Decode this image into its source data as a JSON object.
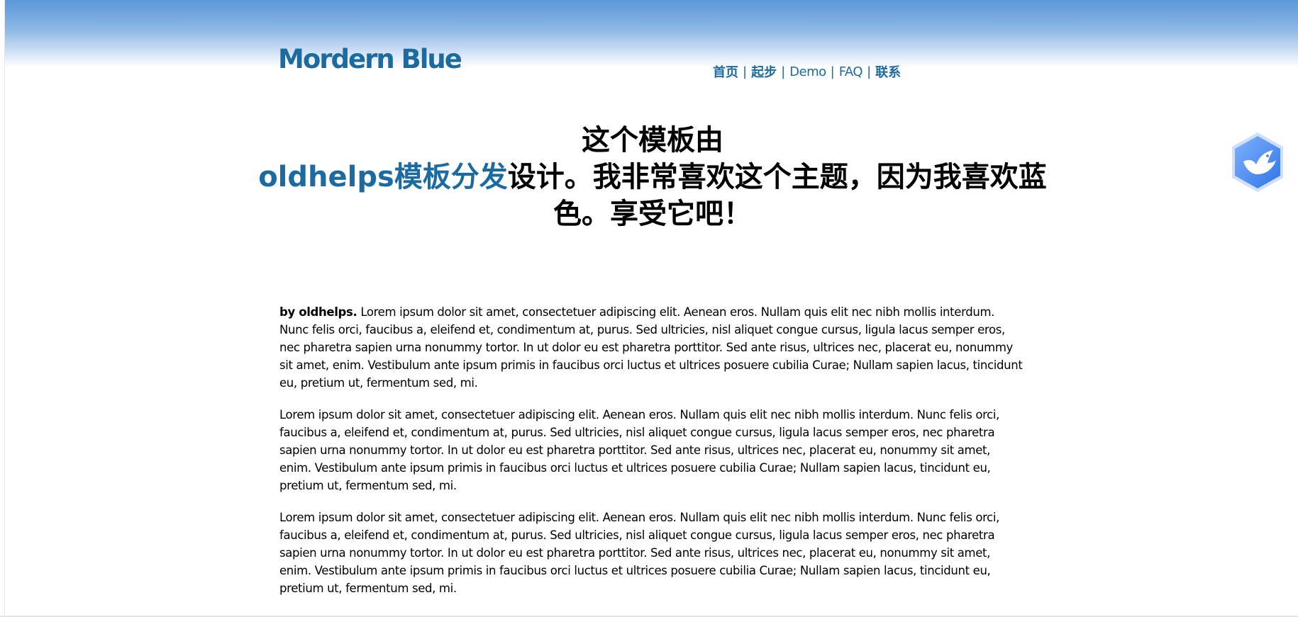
{
  "header": {
    "site_title": "Mordern Blue"
  },
  "nav": {
    "items": [
      {
        "label": "首页"
      },
      {
        "label": "起步"
      },
      {
        "label": "Demo"
      },
      {
        "label": "FAQ"
      },
      {
        "label": "联系"
      }
    ],
    "separator": "|"
  },
  "headline": {
    "line1": "这个模板由",
    "link": "oldhelps模板分发",
    "line2_rest": "设计。我非常喜欢这个主题，因为我喜欢蓝",
    "line3": "色。享受它吧！"
  },
  "content": {
    "paragraph1_author": "by oldhelps.",
    "paragraph1_text": " Lorem ipsum dolor sit amet, consectetuer adipiscing elit. Aenean eros. Nullam quis elit nec nibh mollis interdum. Nunc felis orci, faucibus a, eleifend et, condimentum at, purus. Sed ultricies, nisl aliquet congue cursus, ligula lacus semper eros, nec pharetra sapien urna nonummy tortor. In ut dolor eu est pharetra porttitor. Sed ante risus, ultrices nec, placerat eu, nonummy sit amet, enim. Vestibulum ante ipsum primis in faucibus orci luctus et ultrices posuere cubilia Curae; Nullam sapien lacus, tincidunt eu, pretium ut, fermentum sed, mi.",
    "paragraph2": "Lorem ipsum dolor sit amet, consectetuer adipiscing elit. Aenean eros. Nullam quis elit nec nibh mollis interdum. Nunc felis orci, faucibus a, eleifend et, condimentum at, purus. Sed ultricies, nisl aliquet congue cursus, ligula lacus semper eros, nec pharetra sapien urna nonummy tortor. In ut dolor eu est pharetra porttitor. Sed ante risus, ultrices nec, placerat eu, nonummy sit amet, enim. Vestibulum ante ipsum primis in faucibus orci luctus et ultrices posuere cubilia Curae; Nullam sapien lacus, tincidunt eu, pretium ut, fermentum sed, mi.",
    "paragraph3": "Lorem ipsum dolor sit amet, consectetuer adipiscing elit. Aenean eros. Nullam quis elit nec nibh mollis interdum. Nunc felis orci, faucibus a, eleifend et, condimentum at, purus. Sed ultricies, nisl aliquet congue cursus, ligula lacus semper eros, nec pharetra sapien urna nonummy tortor. In ut dolor eu est pharetra porttitor. Sed ante risus, ultrices nec, placerat eu, nonummy sit amet, enim. Vestibulum ante ipsum primis in faucibus orci luctus et ultrices posuere cubilia Curae; Nullam sapien lacus, tincidunt eu, pretium ut, fermentum sed, mi."
  },
  "widget": {
    "icon": "bird-icon"
  },
  "colors": {
    "brand_blue": "#1b6aa0",
    "header_gradient_top": "#5b97d8",
    "widget_blue": "#4a8ff0"
  }
}
